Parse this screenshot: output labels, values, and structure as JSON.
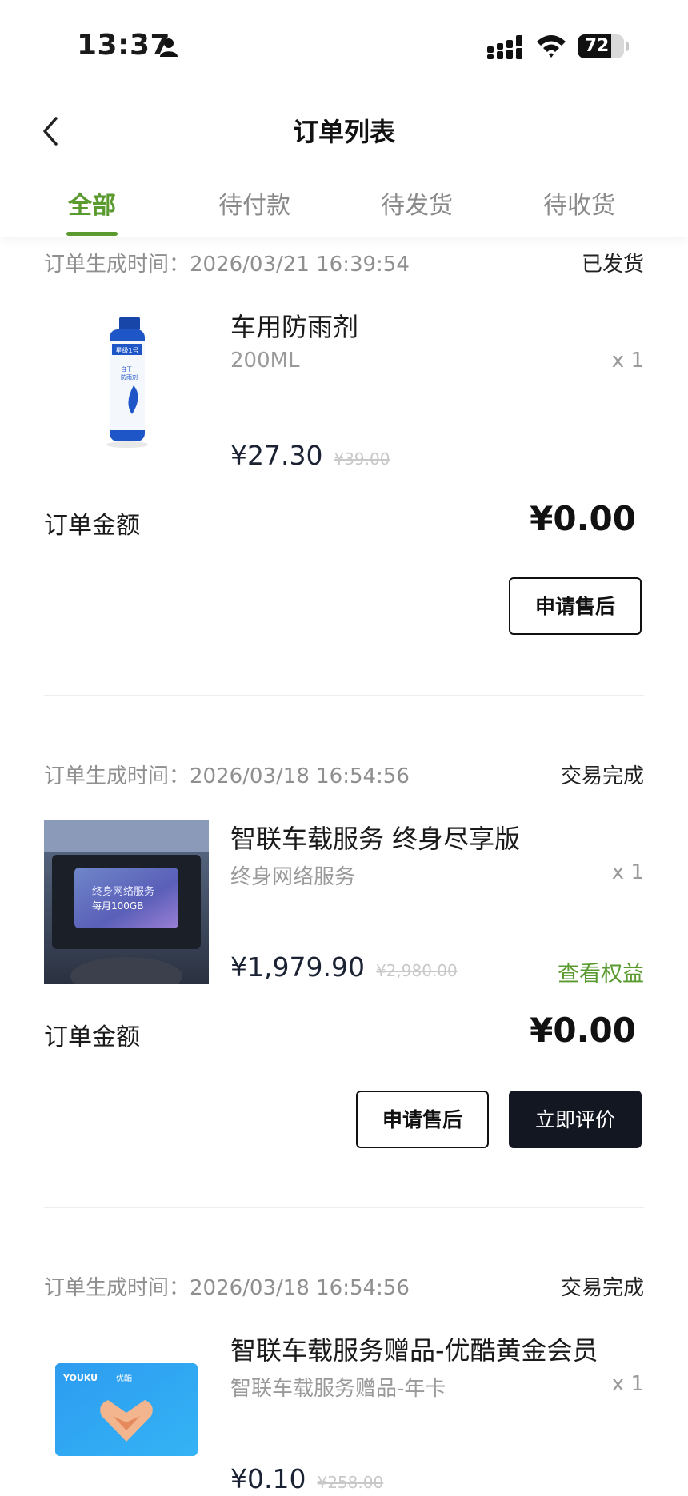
{
  "status_bar": {
    "time": "13:37",
    "battery": "72",
    "battery_level": 0.72
  },
  "nav": {
    "title": "订单列表"
  },
  "tabs": [
    {
      "label": "全部",
      "active": true
    },
    {
      "label": "待付款",
      "active": false
    },
    {
      "label": "待发货",
      "active": false
    },
    {
      "label": "待收货",
      "active": false
    }
  ],
  "orders": [
    {
      "time": "订单生成时间：2026/03/21 16:39:54",
      "status": "已发货",
      "product": {
        "name": "车用防雨剂",
        "spec": "200ML",
        "qty": "x 1",
        "price": "¥27.30",
        "original_price": "¥39.00",
        "image_text": [
          "星级1号",
          "自干",
          "防雨剂"
        ]
      },
      "amount_label": "订单金额",
      "amount": "¥0.00",
      "buttons": [
        "申请售后"
      ]
    },
    {
      "time": "订单生成时间：2026/03/18 16:54:56",
      "status": "交易完成",
      "product": {
        "name": "智联车载服务 终身尽享版",
        "spec": "终身网络服务",
        "qty": "x 1",
        "price": "¥1,979.90",
        "original_price": "¥2,980.00",
        "link": "查看权益",
        "image_text": [
          "终身网络服务",
          "每月100GB"
        ]
      },
      "amount_label": "订单金额",
      "amount": "¥0.00",
      "buttons": [
        "申请售后",
        "立即评价"
      ]
    },
    {
      "time": "订单生成时间：2026/03/18 16:54:56",
      "status": "交易完成",
      "product": {
        "name": "智联车载服务赠品-优酷黄金会员",
        "spec": "智联车载服务赠品-年卡",
        "qty": "x 1",
        "price": "¥0.10",
        "original_price": "¥258.00",
        "image_text": [
          "YOUKU",
          "优酷"
        ]
      }
    }
  ],
  "colors": {
    "accent": "#5a9a2f",
    "dark_button": "#131722"
  }
}
